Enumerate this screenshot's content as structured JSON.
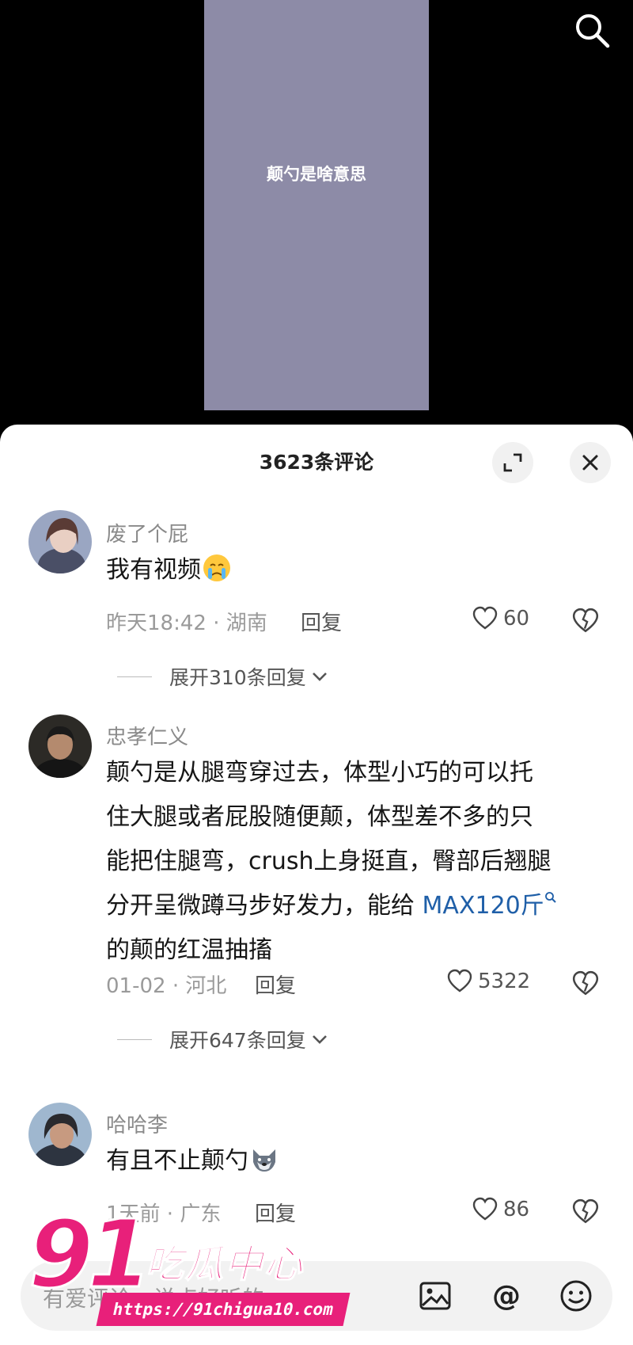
{
  "video": {
    "caption": "颠勺是啥意思",
    "bg_color": "#8d8ba7"
  },
  "sheet": {
    "title": "3623条评论",
    "expand_icon": "fullscreen-expand-icon",
    "close_icon": "close-icon"
  },
  "comments": [
    {
      "username": "废了个屁",
      "text": "我有视频",
      "emoji": "crying-emoji",
      "meta": "昨天18:42 · 湖南",
      "reply_label": "回复",
      "likes": "60",
      "expand_label": "展开310条回复"
    },
    {
      "username": "忠孝仁义",
      "text_lines": [
        "颠勺是从腿弯穿过去，体型小巧的可以托",
        "住大腿或者屁股随便颠，体型差不多的只",
        "能把住腿弯，crush上身挺直，臀部后翘腿",
        "分开呈微蹲马步好发力，能给 "
      ],
      "link_text": "MAX120斤",
      "text_tail": "的颠的红温抽搐",
      "meta": "01-02 · 河北",
      "reply_label": "回复",
      "likes": "5322",
      "expand_label": "展开647条回复"
    },
    {
      "username": "哈哈李",
      "text": "有且不止颠勺",
      "emoji": "wolf-emoji",
      "meta": "1天前 · 广东",
      "reply_label": "回复",
      "likes": "86"
    }
  ],
  "input": {
    "placeholder": "有爱评论，说点好听的",
    "image_icon": "image-icon",
    "at_icon": "at-icon",
    "emoji_icon": "emoji-icon"
  },
  "watermark": {
    "number": "91",
    "name": "吃瓜中心",
    "url": "https://91chigua10.com"
  }
}
